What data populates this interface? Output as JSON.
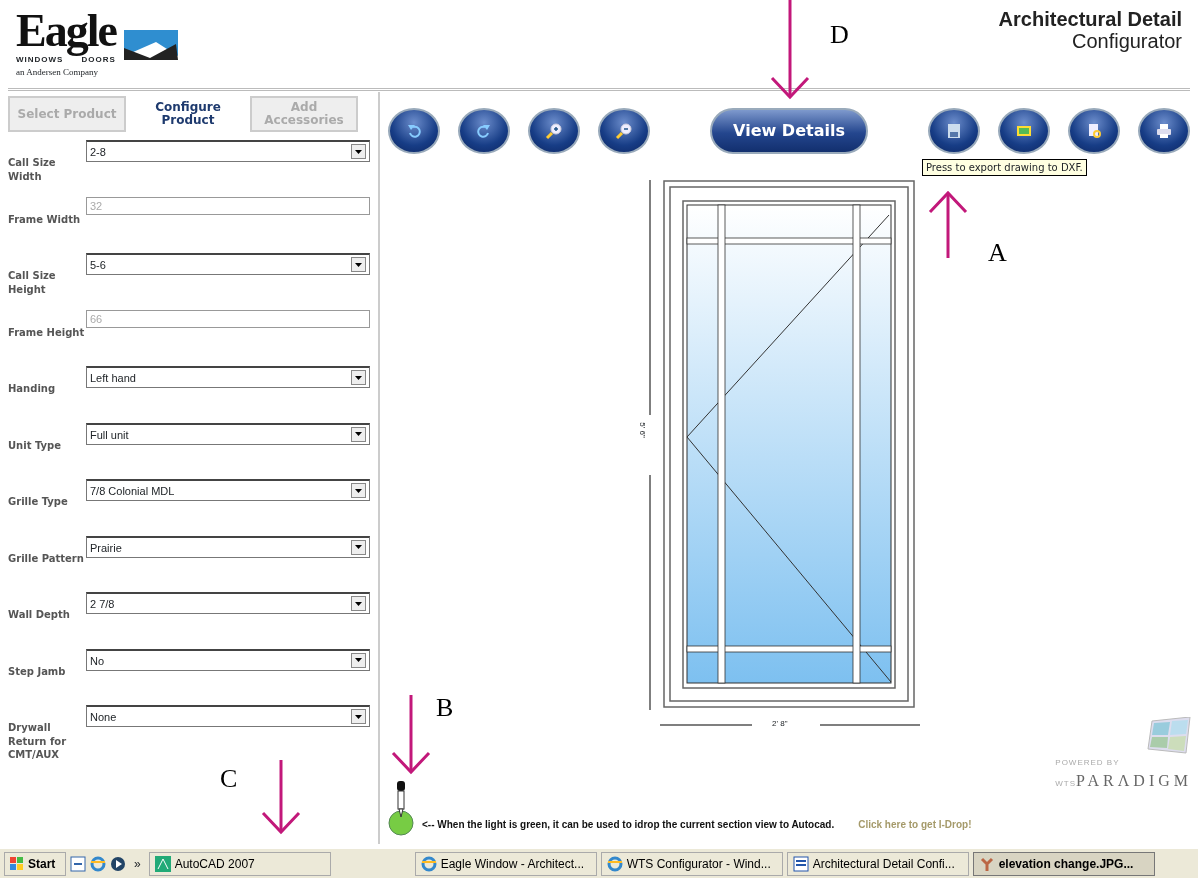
{
  "header": {
    "logo_word": "Eagle",
    "logo_sub_left": "WINDOWS",
    "logo_sub_right": "DOORS",
    "logo_tagline": "an Andersen Company",
    "title_line1": "Architectural Detail",
    "title_line2": "Configurator"
  },
  "tabs": [
    {
      "label": "Select Product",
      "selected": false
    },
    {
      "label": "Configure Product",
      "selected": true
    },
    {
      "label": "Add Accessories",
      "selected": false
    }
  ],
  "fields": [
    {
      "label": "Call Size Width",
      "kind": "select",
      "value": "2-8"
    },
    {
      "label": "Frame Width",
      "kind": "readonly",
      "value": "32"
    },
    {
      "label": "Call Size Height",
      "kind": "select",
      "value": "5-6"
    },
    {
      "label": "Frame Height",
      "kind": "readonly",
      "value": "66"
    },
    {
      "label": "Handing",
      "kind": "select",
      "value": "Left hand"
    },
    {
      "label": "Unit Type",
      "kind": "select",
      "value": "Full unit"
    },
    {
      "label": "Grille Type",
      "kind": "select",
      "value": "7/8 Colonial MDL"
    },
    {
      "label": "Grille Pattern",
      "kind": "select",
      "value": "Prairie"
    },
    {
      "label": "Wall Depth",
      "kind": "select",
      "value": "2 7/8"
    },
    {
      "label": "Step Jamb",
      "kind": "select",
      "value": "No"
    },
    {
      "label": "Drywall Return for CMT/AUX",
      "kind": "select",
      "value": "None"
    }
  ],
  "toolbar": [
    {
      "kind": "undo"
    },
    {
      "kind": "redo"
    },
    {
      "kind": "zoom-in"
    },
    {
      "kind": "zoom-out"
    },
    {
      "kind": "text",
      "label": "View Details"
    },
    {
      "kind": "save"
    },
    {
      "kind": "image"
    },
    {
      "kind": "preview"
    },
    {
      "kind": "print"
    }
  ],
  "tooltip": "Press to export drawing to DXF.",
  "drawing": {
    "height_label": "5' 6\"",
    "width_label": "2' 8\""
  },
  "idrop": {
    "light_on": true,
    "message": "<-- When the light is green, it can be used to idrop the current section view to Autocad.",
    "link": "Click here to get I-Drop!"
  },
  "paradigm": {
    "powered": "POWERED BY",
    "prefix": "WTS",
    "name": "PARΛDIGM"
  },
  "annotations": [
    {
      "label": "D"
    },
    {
      "label": "A"
    },
    {
      "label": "B"
    },
    {
      "label": "C"
    }
  ],
  "taskbar": {
    "start": "Start",
    "chevron": "»",
    "items": [
      {
        "label": "AutoCAD 2007",
        "selected": false
      },
      {
        "label": "Eagle Window - Architect...",
        "selected": false
      },
      {
        "label": "WTS Configurator - Wind...",
        "selected": false
      },
      {
        "label": "Architectural Detail Confi...",
        "selected": false
      },
      {
        "label": "elevation change.JPG...",
        "selected": true
      }
    ]
  }
}
